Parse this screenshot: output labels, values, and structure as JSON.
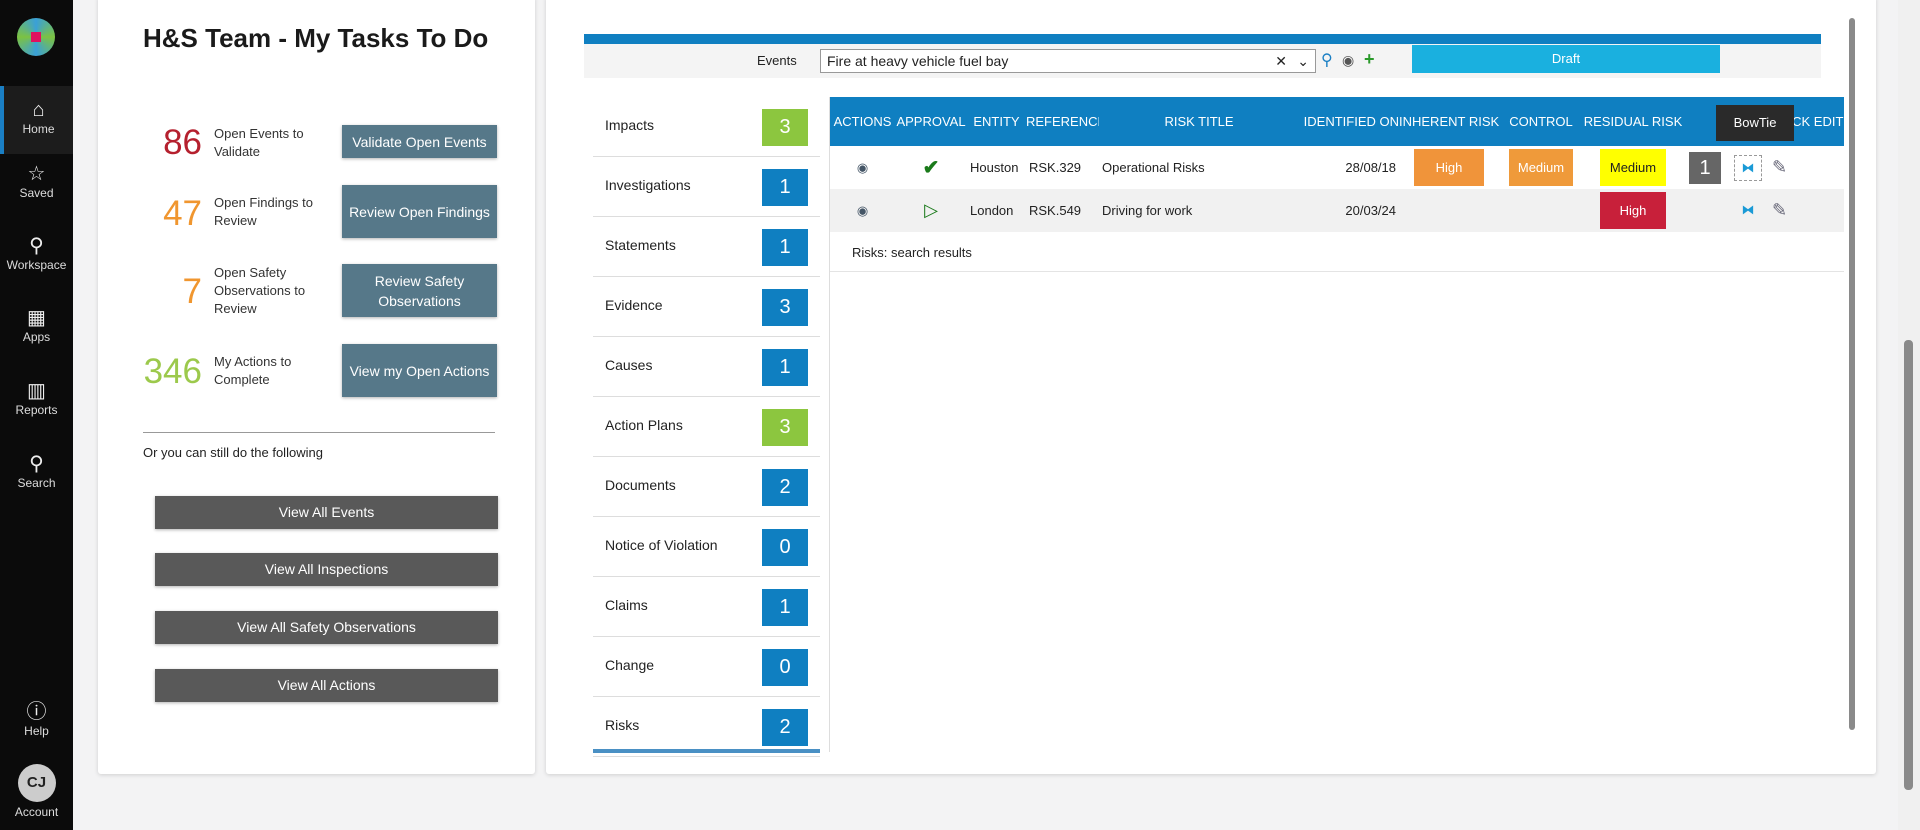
{
  "sidebar": {
    "items": [
      {
        "label": "Home",
        "icon": "home-icon"
      },
      {
        "label": "Saved",
        "icon": "star-icon"
      },
      {
        "label": "Workspace",
        "icon": "map-pin-icon"
      },
      {
        "label": "Apps",
        "icon": "grid-icon"
      },
      {
        "label": "Reports",
        "icon": "chart-icon"
      },
      {
        "label": "Search",
        "icon": "search-icon"
      }
    ],
    "help": "Help",
    "account": "Account",
    "account_initials": "CJ"
  },
  "tasks": {
    "title": "H&S Team - My Tasks To Do",
    "stats": [
      {
        "count": "86",
        "label": "Open Events to Validate",
        "button": "Validate Open Events",
        "color": "#b5202e"
      },
      {
        "count": "47",
        "label": "Open Findings to Review",
        "button": "Review Open Findings",
        "color": "#f0962f"
      },
      {
        "count": "7",
        "label": "Open Safety Observations to Review",
        "button": "Review Safety Observations",
        "color": "#f0962f"
      },
      {
        "count": "346",
        "label": "My Actions to Complete",
        "button": "View my Open Actions",
        "color": "#9cc94c"
      }
    ],
    "or_text": "Or you can still do the following",
    "links": [
      "View All Events",
      "View All Inspections",
      "View All Safety Observations",
      "View All Actions"
    ]
  },
  "event": {
    "label": "Events",
    "value": "Fire at heavy vehicle fuel bay",
    "status": "Draft"
  },
  "categories": [
    {
      "label": "Impacts",
      "count": "3",
      "color": "#8cc63f"
    },
    {
      "label": "Investigations",
      "count": "1",
      "color": "#0f7fc1"
    },
    {
      "label": "Statements",
      "count": "1",
      "color": "#0f7fc1"
    },
    {
      "label": "Evidence",
      "count": "3",
      "color": "#0f7fc1"
    },
    {
      "label": "Causes",
      "count": "1",
      "color": "#0f7fc1"
    },
    {
      "label": "Action Plans",
      "count": "3",
      "color": "#8cc63f"
    },
    {
      "label": "Documents",
      "count": "2",
      "color": "#0f7fc1"
    },
    {
      "label": "Notice of Violation",
      "count": "0",
      "color": "#0f7fc1"
    },
    {
      "label": "Claims",
      "count": "1",
      "color": "#0f7fc1"
    },
    {
      "label": "Change",
      "count": "0",
      "color": "#0f7fc1"
    },
    {
      "label": "Risks",
      "count": "2",
      "color": "#0f7fc1"
    }
  ],
  "risks": {
    "headers": [
      "ACTIONS",
      "APPROVAL",
      "ENTITY",
      "REFERENCE",
      "RISK TITLE",
      "IDENTIFIED ON",
      "INHERENT RISK",
      "CONTROL",
      "RESIDUAL RISK",
      "",
      "",
      "QUICK EDIT"
    ],
    "rows": [
      {
        "approval": "approved",
        "entity": "Houston",
        "reference": "RSK.329",
        "title": "Operational Risks",
        "identified": "28/08/18",
        "inherent": "High",
        "inherent_color": "#f0943a",
        "control": "Medium",
        "control_color": "#ef9a3a",
        "residual": "Medium",
        "residual_color": "#ffff00",
        "count": "1"
      },
      {
        "approval": "pending",
        "entity": "London",
        "reference": "RSK.549",
        "title": "Driving for work",
        "identified": "20/03/24",
        "inherent": "",
        "control": "",
        "residual": "High",
        "residual_color": "#c8203a",
        "count": ""
      }
    ],
    "footer": "Risks: search results",
    "tooltip": "BowTie"
  }
}
